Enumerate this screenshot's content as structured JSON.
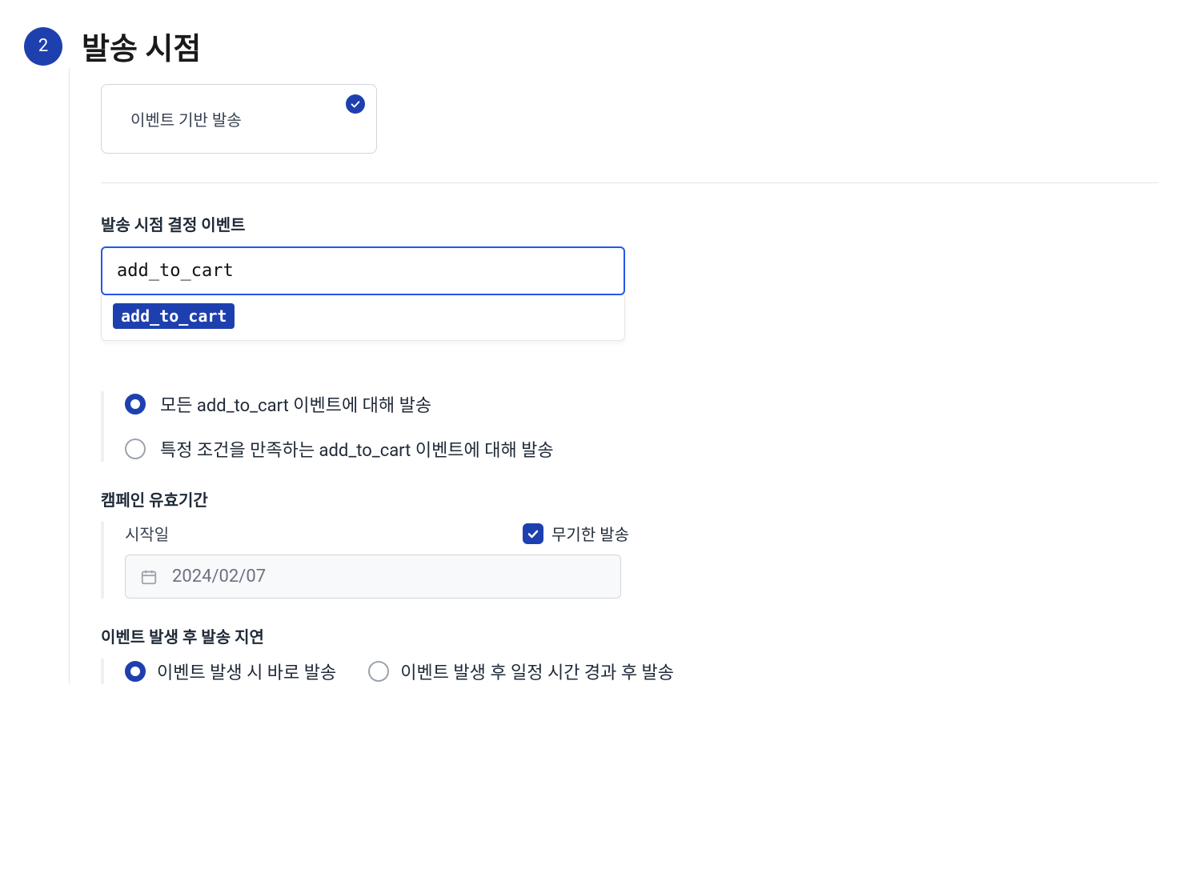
{
  "step": {
    "number": "2",
    "title": "발송 시점"
  },
  "sendType": {
    "label": "이벤트 기반 발송"
  },
  "eventSelect": {
    "label": "발송 시점 결정 이벤트",
    "value": "add_to_cart",
    "option": "add_to_cart"
  },
  "conditionRadios": {
    "all": "모든 add_to_cart 이벤트에 대해 발송",
    "specific": "특정 조건을 만족하는 add_to_cart 이벤트에 대해 발송"
  },
  "validity": {
    "sectionLabel": "캠페인 유효기간",
    "startLabel": "시작일",
    "unlimitedLabel": "무기한 발송",
    "dateValue": "2024/02/07"
  },
  "delay": {
    "sectionLabel": "이벤트 발생 후 발송 지연",
    "immediate": "이벤트 발생 시 바로 발송",
    "delayed": "이벤트 발생 후 일정 시간 경과 후 발송"
  }
}
